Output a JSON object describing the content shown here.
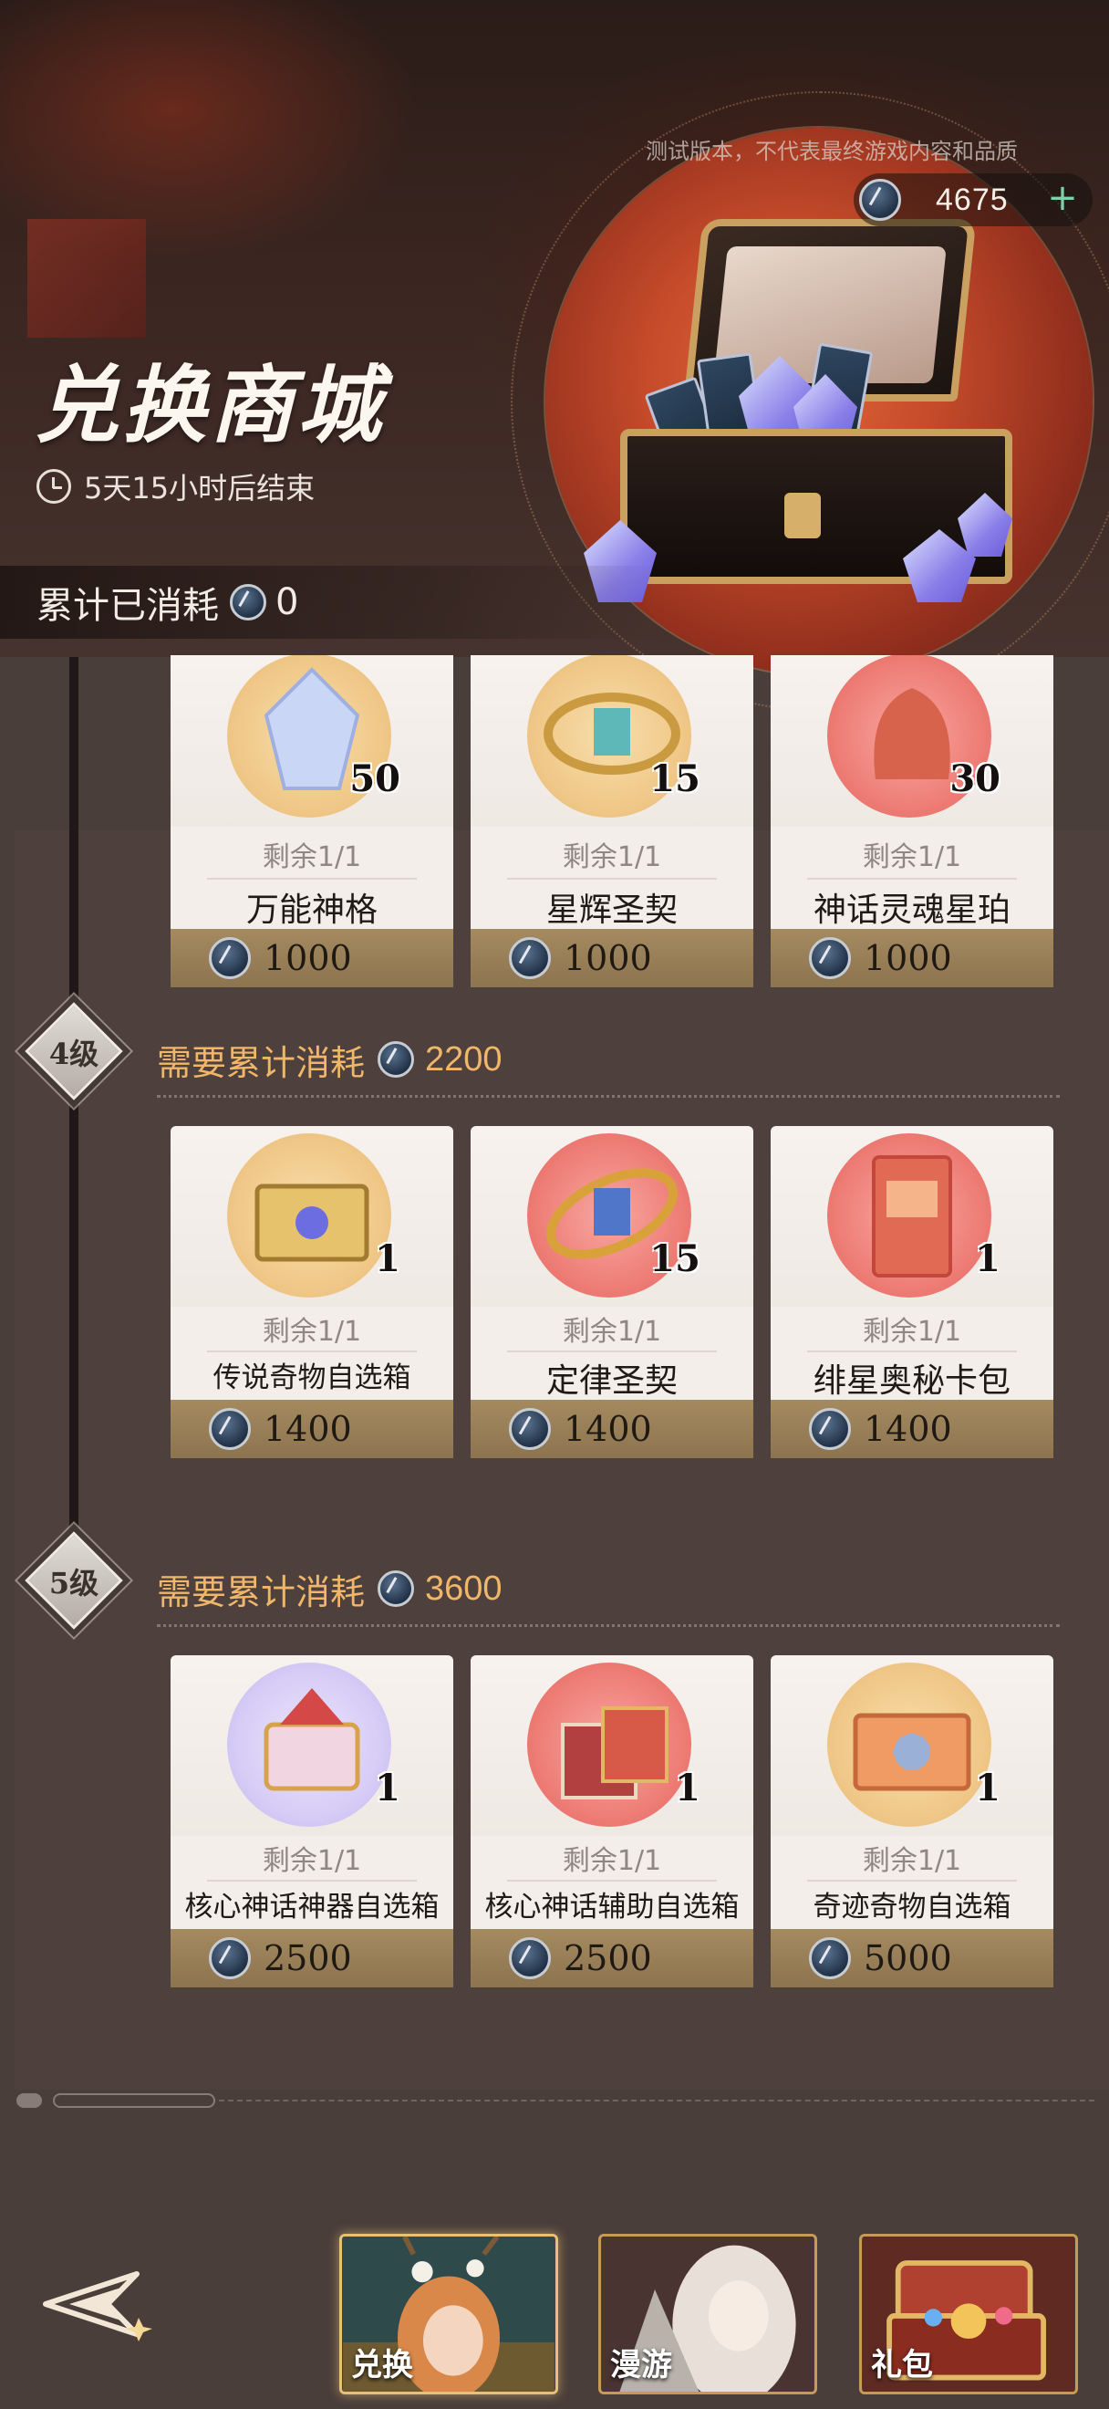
{
  "header": {
    "disclaimer": "测试版本，不代表最终游戏内容和品质",
    "currency_amount": "4675",
    "plus_label": "+",
    "title": "兑换商城",
    "countdown": "5天15小时后结束",
    "accumulated_label": "累计已消耗",
    "accumulated_value": "0"
  },
  "tiers": [
    {
      "items": [
        {
          "name": "万能神格",
          "qty": "50",
          "remain": "剩余1/1",
          "price": "1000",
          "badge": "gold"
        },
        {
          "name": "星辉圣契",
          "qty": "15",
          "remain": "剩余1/1",
          "price": "1000",
          "badge": "gold"
        },
        {
          "name": "神话灵魂星珀",
          "qty": "30",
          "remain": "剩余1/1",
          "price": "1000",
          "badge": "red"
        }
      ]
    },
    {
      "level": "4级",
      "requirement_label": "需要累计消耗",
      "requirement_value": "2200",
      "items": [
        {
          "name": "传说奇物自选箱",
          "qty": "1",
          "remain": "剩余1/1",
          "price": "1400",
          "badge": "gold"
        },
        {
          "name": "定律圣契",
          "qty": "15",
          "remain": "剩余1/1",
          "price": "1400",
          "badge": "red"
        },
        {
          "name": "绯星奥秘卡包",
          "qty": "1",
          "remain": "剩余1/1",
          "price": "1400",
          "badge": "red"
        }
      ]
    },
    {
      "level": "5级",
      "requirement_label": "需要累计消耗",
      "requirement_value": "3600",
      "items": [
        {
          "name": "核心神话神器自选箱",
          "qty": "1",
          "remain": "剩余1/1",
          "price": "2500",
          "badge": "purple"
        },
        {
          "name": "核心神话辅助自选箱",
          "qty": "1",
          "remain": "剩余1/1",
          "price": "2500",
          "badge": "red"
        },
        {
          "name": "奇迹奇物自选箱",
          "qty": "1",
          "remain": "剩余1/1",
          "price": "5000",
          "badge": "gold"
        }
      ]
    }
  ],
  "bottom_nav": {
    "tabs": [
      {
        "label": "兑换",
        "active": true
      },
      {
        "label": "漫游",
        "active": false
      },
      {
        "label": "礼包",
        "active": false
      }
    ]
  },
  "icons": {
    "currency": "star-coin-icon",
    "clock": "clock-icon",
    "back": "back-arrow-icon"
  },
  "colors": {
    "accent_gold": "#f0b66a",
    "price_bar": "#a58a5f",
    "badge_gold": "#f0c98a",
    "badge_red": "#ee7f78",
    "badge_purple": "#d7cdf6"
  }
}
